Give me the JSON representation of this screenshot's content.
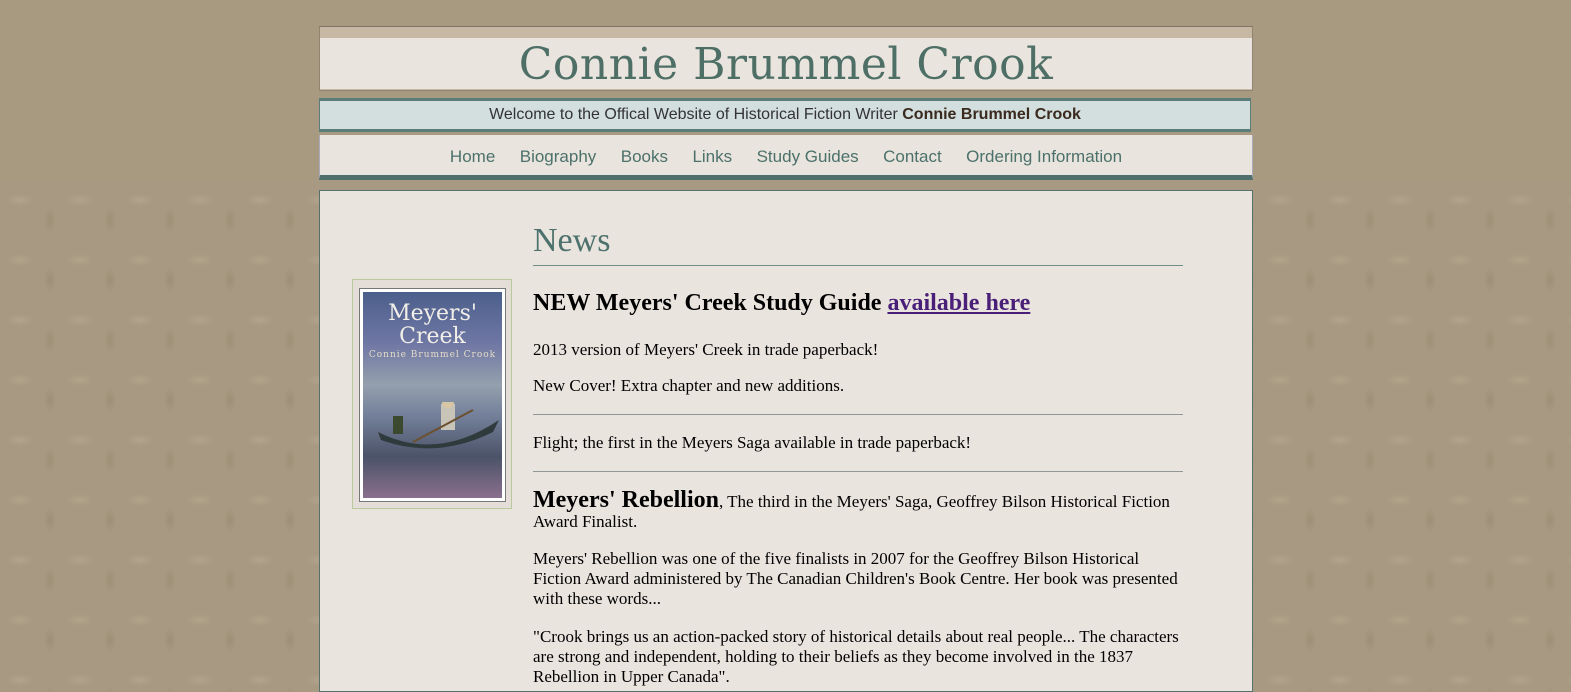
{
  "header": {
    "site_title": "Connie Brummel Crook",
    "tagline_prefix": "Welcome to the Offical Website of Historical Fiction Writer ",
    "tagline_name": "Connie Brummel Crook"
  },
  "nav": {
    "items": [
      "Home",
      "Biography",
      "Books",
      "Links",
      "Study Guides",
      "Contact",
      "Ordering Information"
    ]
  },
  "sidebar": {
    "cover_title": "Meyers' Creek",
    "cover_author": "Connie Brummel Crook"
  },
  "main": {
    "heading": "News",
    "headline_text": "NEW Meyers' Creek Study Guide ",
    "headline_link": "available here",
    "p1": "2013 version of Meyers' Creek in trade paperback!",
    "p2": "New Cover! Extra chapter and new additions.",
    "p3": "Flight; the first in the Meyers Saga available in trade paperback!",
    "rebellion_title": "Meyers' Rebellion",
    "rebellion_rest": ", The third in the Meyers' Saga, Geoffrey Bilson Historical Fiction Award Finalist.",
    "p4": "Meyers' Rebellion was one of the five finalists in 2007 for the Geoffrey Bilson Historical Fiction Award administered by The Canadian Children's Book Centre. Her book was presented with these words...",
    "p5": "\"Crook brings us an action-packed story of historical details about real people... The characters are strong and independent, holding to their beliefs as they become involved in the 1837 Rebellion in Upper Canada\"."
  },
  "colors": {
    "title_green": "#4e6f66",
    "link_purple": "#4a1f78",
    "nav_border": "#4f6f6c"
  }
}
